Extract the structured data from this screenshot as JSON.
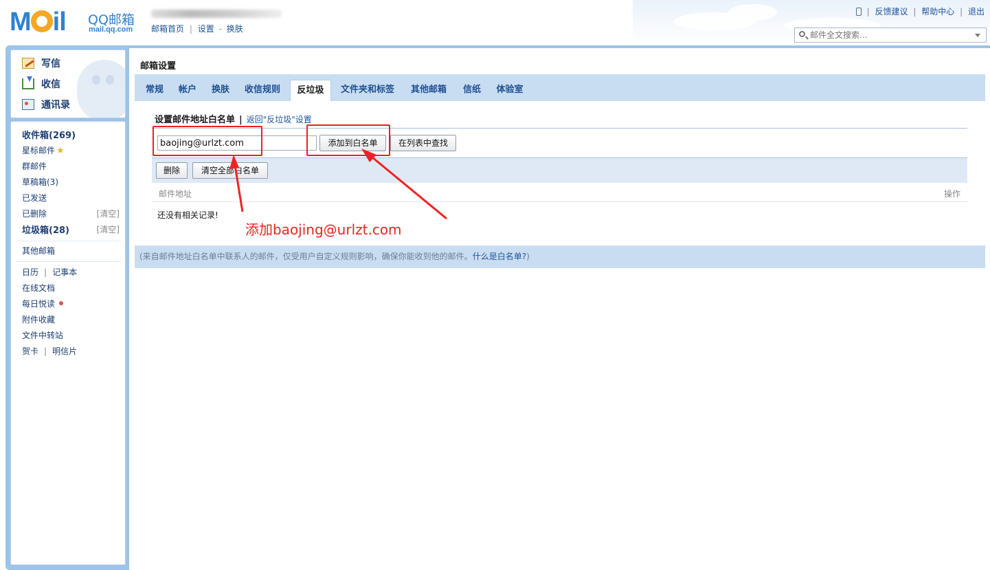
{
  "header": {
    "logo_mail": "M il",
    "logo_qq": "QQ邮箱",
    "logo_domain": "mail.qq.com",
    "links": [
      "邮箱首页",
      "设置",
      "换肤"
    ],
    "top_right_links": [
      "反馈建议",
      "帮助中心",
      "退出"
    ],
    "search_placeholder": "邮件全文搜索..."
  },
  "sidebar": {
    "quick_actions": [
      "写信",
      "收信",
      "通讯录"
    ],
    "folders": {
      "inbox": "收件箱(269)",
      "starred": "星标邮件",
      "group": "群邮件",
      "drafts": "草稿箱(3)",
      "sent": "已发送",
      "deleted": "已删除",
      "spam": "垃圾箱(28)",
      "clear_label": "[清空]"
    },
    "other_mailbox": "其他邮箱",
    "apps": {
      "calendar": "日历",
      "notebook": "记事本",
      "docs": "在线文档",
      "daily": "每日悦读",
      "attachments": "附件收藏",
      "transfer": "文件中转站",
      "card": "贺卡",
      "postcard": "明信片"
    }
  },
  "main": {
    "title": "邮箱设置",
    "tabs": [
      "常规",
      "帐户",
      "换肤",
      "收信规则",
      "反垃圾",
      "文件夹和标签",
      "其他邮箱",
      "信纸",
      "体验室"
    ],
    "active_tab": "反垃圾",
    "section_title": "设置邮件地址白名单",
    "section_sep": "|",
    "back_link": "返回\"反垃圾\"设置",
    "email_value": "baojing@urlzt.com",
    "add_button": "添加到白名单",
    "find_button": "在列表中查找",
    "delete_button": "删除",
    "clear_all_button": "清空全部白名单",
    "col_address": "邮件地址",
    "col_action": "操作",
    "empty_text": "还没有相关记录!",
    "footnote_text": "(来自邮件地址白名单中联系人的邮件，仅受用户自定义规则影响，确保你能收到他的邮件。",
    "footnote_link": "什么是白名单?",
    "footnote_end": ")"
  },
  "annotation": {
    "text": "添加baojing@urlzt.com",
    "color": "#ee2222"
  }
}
